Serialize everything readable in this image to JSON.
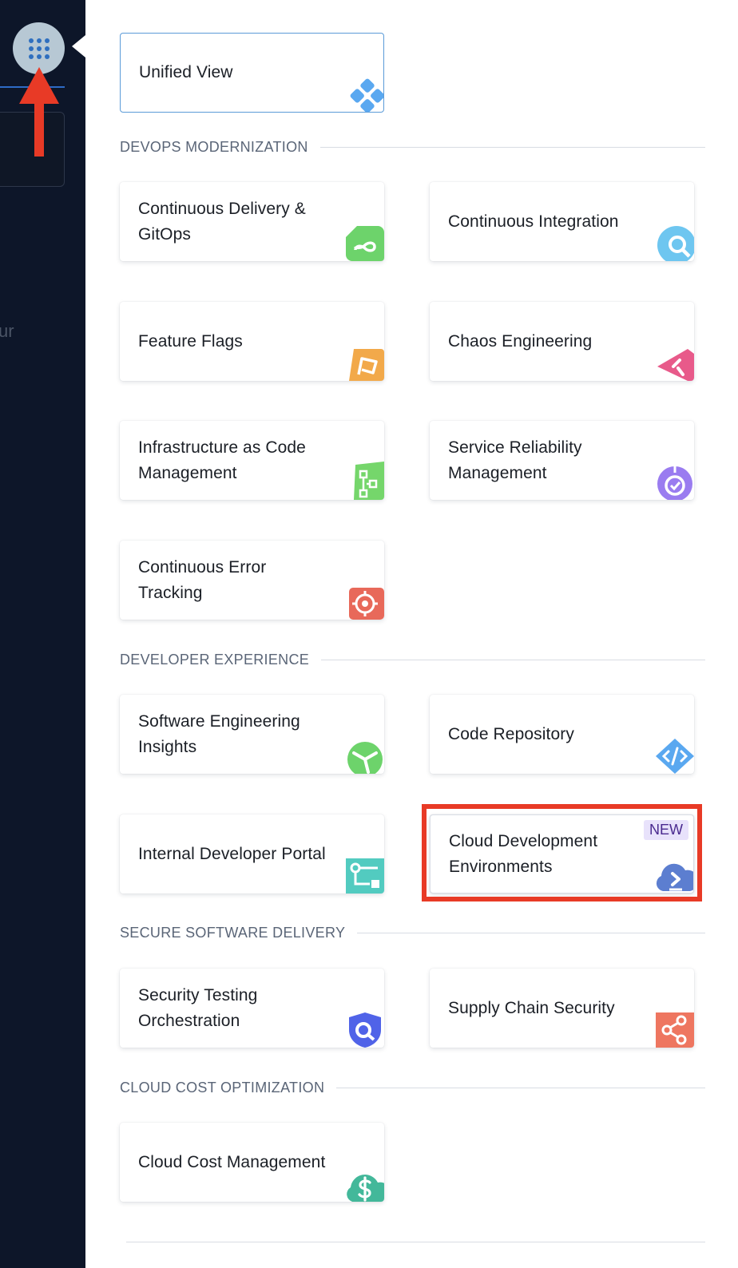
{
  "sidebar": {
    "faded_text": "ur"
  },
  "unified_view": {
    "label": "Unified View"
  },
  "sections": [
    {
      "title": "DEVOPS MODERNIZATION",
      "tiles": [
        {
          "label": "Continuous Delivery & GitOps",
          "icon": "infinity-icon",
          "color": "#6dd36b"
        },
        {
          "label": "Continuous Integration",
          "icon": "search-build-icon",
          "color": "#6ec6f0"
        },
        {
          "label": "Feature Flags",
          "icon": "flag-icon",
          "color": "#f2a94a"
        },
        {
          "label": "Chaos Engineering",
          "icon": "chaos-icon",
          "color": "#e85a8a"
        },
        {
          "label": "Infrastructure as Code Management",
          "icon": "iac-icon",
          "color": "#75d66b"
        },
        {
          "label": "Service Reliability Management",
          "icon": "srm-icon",
          "color": "#9a7cf0"
        },
        {
          "label": "Continuous Error Tracking",
          "icon": "target-icon",
          "color": "#e8695a"
        }
      ]
    },
    {
      "title": "DEVELOPER EXPERIENCE",
      "tiles": [
        {
          "label": "Software Engineering Insights",
          "icon": "sei-icon",
          "color": "#6dd36b"
        },
        {
          "label": "Code Repository",
          "icon": "code-icon",
          "color": "#5aa8f0"
        },
        {
          "label": "Internal Developer Portal",
          "icon": "idp-icon",
          "color": "#52cbc0"
        },
        {
          "label": "Cloud Development Environments",
          "icon": "cloud-terminal-icon",
          "color": "#5c7ed0",
          "badge": "NEW"
        }
      ]
    },
    {
      "title": "SECURE SOFTWARE DELIVERY",
      "tiles": [
        {
          "label": "Security Testing Orchestration",
          "icon": "shield-search-icon",
          "color": "#5063e8"
        },
        {
          "label": "Supply Chain Security",
          "icon": "share-nodes-icon",
          "color": "#ee7660"
        }
      ]
    },
    {
      "title": "CLOUD COST OPTIMIZATION",
      "tiles": [
        {
          "label": "Cloud Cost Management",
          "icon": "cloud-dollar-icon",
          "color": "#43b89a"
        }
      ]
    }
  ],
  "colors": {
    "sidebar_bg": "#0d1629",
    "highlight": "#e83a26",
    "section_text": "#5a6577"
  }
}
